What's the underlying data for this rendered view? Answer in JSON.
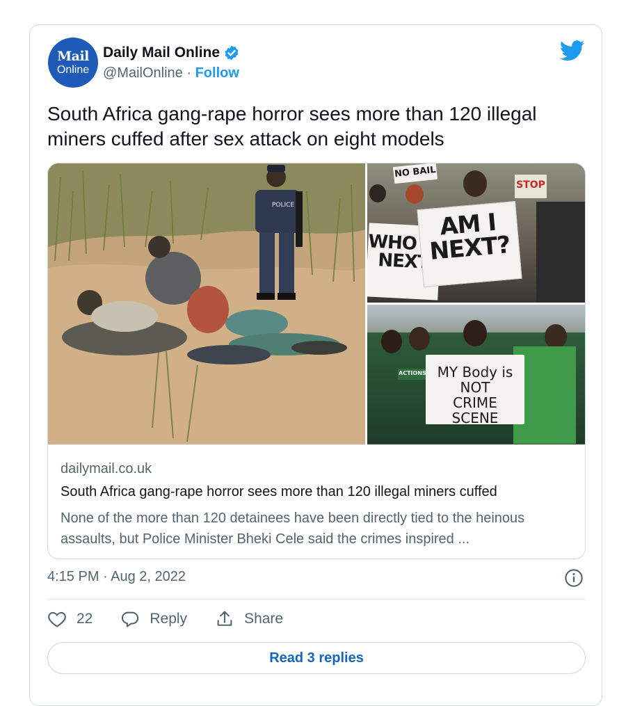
{
  "account": {
    "avatar_line1": "Mail",
    "avatar_line2": "Online",
    "name": "Daily Mail Online",
    "handle": "@MailOnline",
    "separator": " · ",
    "follow_label": "Follow"
  },
  "tweet": {
    "text": "South Africa gang-rape horror sees more than 120 illegal miners cuffed after sex attack on eight models"
  },
  "images": {
    "police_patch": "POLICE",
    "sign_no_bail": "NO BAIL",
    "sign_stop": "STOP",
    "sign_am_i_next": "AM I NEXT?",
    "sign_who_is_next": "WHO IS NEXT",
    "sign_my_body": "MY Body is NOT CRIME SCENE",
    "sign_shirt": "ACTIONSA"
  },
  "link_card": {
    "domain": "dailymail.co.uk",
    "title": "South Africa gang-rape horror sees more than 120 illegal miners cuffed",
    "description": "None of the more than 120 detainees have been directly tied to the heinous assaults, but Police Minister Bheki Cele said the crimes inspired ..."
  },
  "meta": {
    "timestamp": "4:15 PM · Aug 2, 2022"
  },
  "actions": {
    "like_count": "22",
    "reply_label": "Reply",
    "share_label": "Share"
  },
  "footer": {
    "read_replies_label": "Read 3 replies"
  },
  "colors": {
    "link_blue": "#1d9bf0",
    "avatar_blue": "#1e5bb8",
    "text_gray": "#536471",
    "border": "#cfd9de"
  },
  "icons": [
    "verified-badge-icon",
    "twitter-bird-icon",
    "info-icon",
    "heart-icon",
    "reply-icon",
    "share-icon"
  ]
}
